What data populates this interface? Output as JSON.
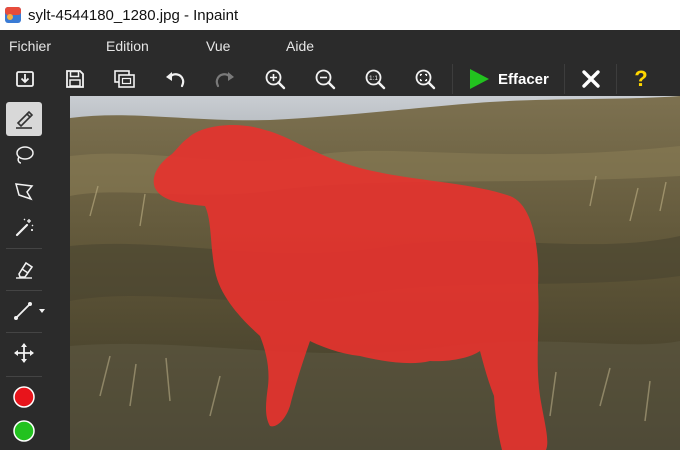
{
  "window": {
    "title": "sylt-4544180_1280.jpg - Inpaint",
    "app_icon": "inpaint-app-icon"
  },
  "menu": {
    "items": [
      "Fichier",
      "Edition",
      "Vue",
      "Aide"
    ]
  },
  "toolbar": {
    "buttons": [
      {
        "name": "open-icon"
      },
      {
        "name": "save-icon"
      },
      {
        "name": "batch-icon"
      },
      {
        "name": "undo-icon"
      },
      {
        "name": "redo-icon"
      },
      {
        "name": "zoom-in-icon"
      },
      {
        "name": "zoom-out-icon"
      },
      {
        "name": "zoom-actual-size-icon",
        "label": "1:1"
      },
      {
        "name": "zoom-fit-icon"
      }
    ],
    "run_label": "Effacer",
    "help_label": "?",
    "colors": {
      "accent_green": "#22c21f",
      "help_yellow": "#ffd600"
    }
  },
  "tools": {
    "items": [
      {
        "name": "marker-tool-icon",
        "active": true
      },
      {
        "name": "lasso-tool-icon",
        "active": false
      },
      {
        "name": "polygonal-lasso-tool-icon",
        "active": false
      },
      {
        "name": "magic-wand-tool-icon",
        "active": false
      },
      {
        "name": "eraser-tool-icon",
        "active": false
      },
      {
        "name": "guide-line-tool-icon",
        "active": false
      },
      {
        "name": "move-tool-icon",
        "active": false
      },
      {
        "name": "red-marker-color-icon",
        "active": false
      },
      {
        "name": "green-marker-color-icon",
        "active": false
      }
    ],
    "colors": {
      "red_marker": "#e8141b",
      "green_marker": "#22c21f"
    }
  },
  "canvas": {
    "image": "sheep-on-dune-photo",
    "selection_color": "#e8322e"
  }
}
